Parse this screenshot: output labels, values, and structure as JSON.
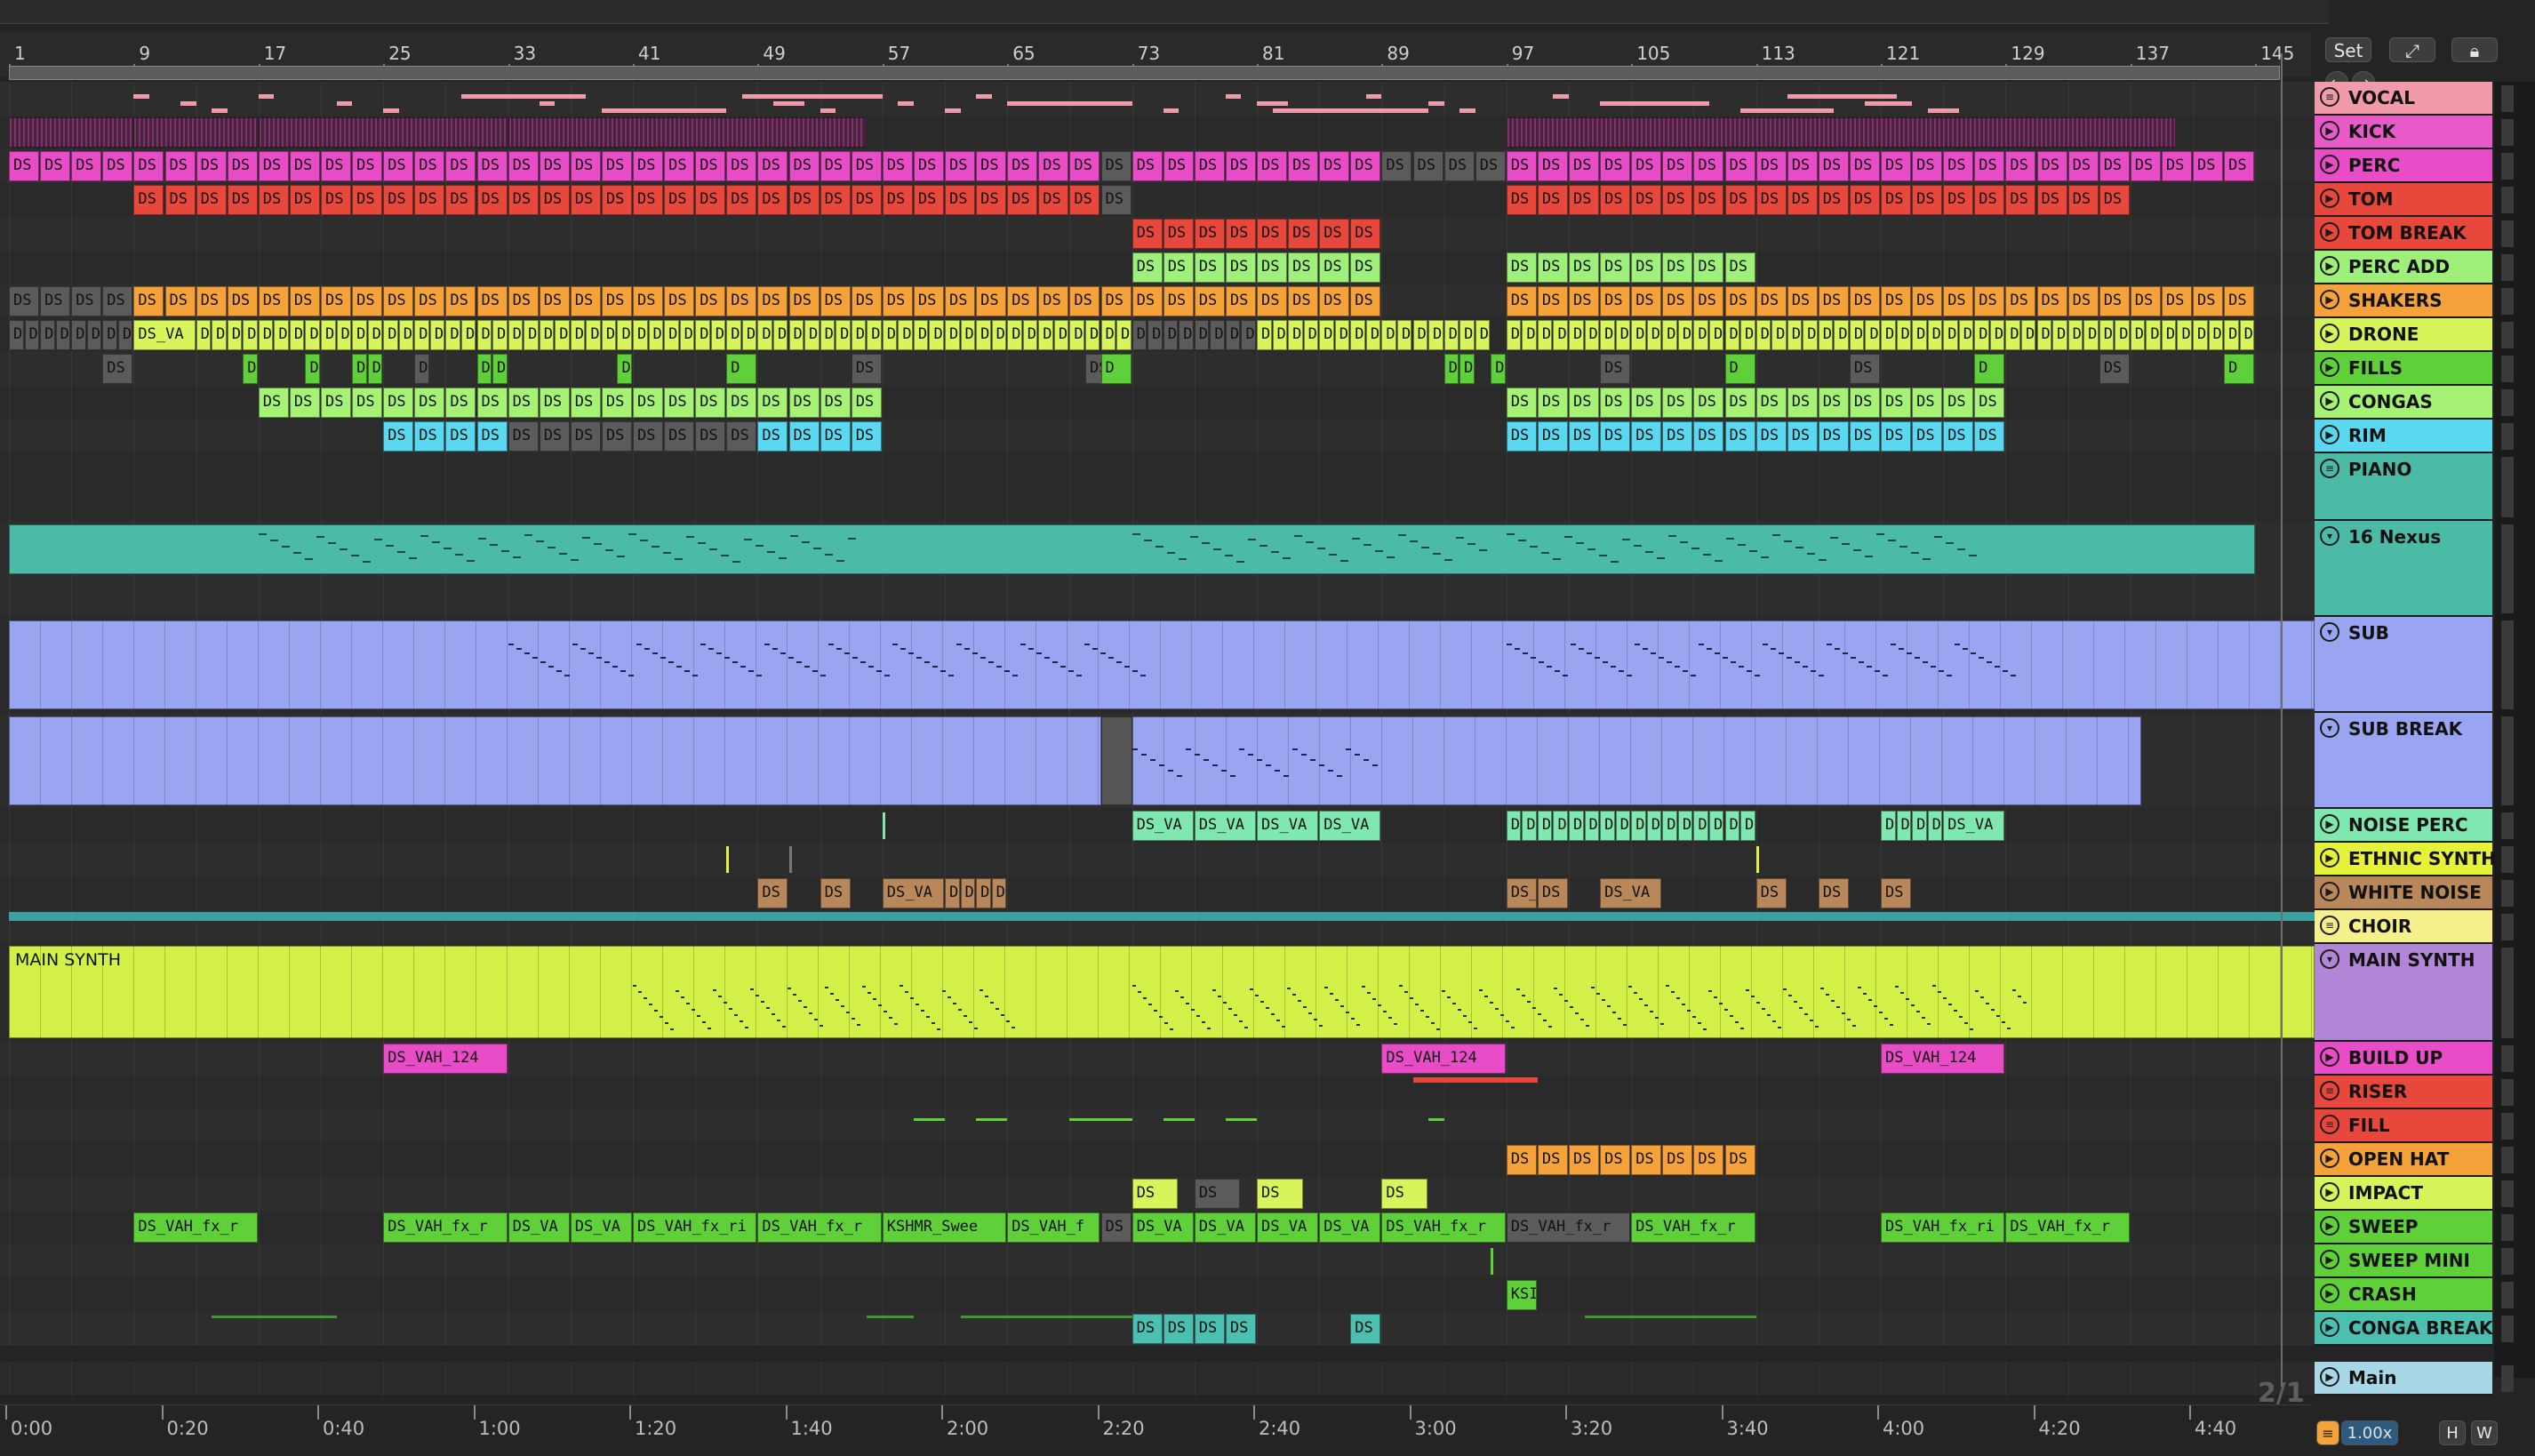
{
  "session": {
    "set_button": "Set",
    "time_signature": "2/1",
    "zoom": "1.00x",
    "h_button": "H",
    "w_button": "W"
  },
  "ruler": {
    "bars": [
      "1",
      "9",
      "17",
      "25",
      "33",
      "41",
      "49",
      "57",
      "65",
      "73",
      "81",
      "89",
      "97",
      "105",
      "113",
      "121",
      "129",
      "137",
      "145"
    ]
  },
  "time_ruler": {
    "times": [
      "0:00",
      "0:20",
      "0:40",
      "1:00",
      "1:20",
      "1:40",
      "2:00",
      "2:20",
      "2:40",
      "3:00",
      "3:20",
      "3:40",
      "4:00",
      "4:20",
      "4:40"
    ]
  },
  "colors": {
    "vocal": "#f09aaa",
    "kick": "#e85ac8",
    "perc": "#e84cc6",
    "tom": "#e8473c",
    "tom_break": "#e8473c",
    "perc_add": "#9ef07a",
    "shakers": "#f5a23a",
    "drone": "#d7f55a",
    "fills": "#5fd03a",
    "congas": "#a6f275",
    "rim": "#5ad8f0",
    "piano": "#4bbba8",
    "nexus": "#4bbba8",
    "sub": "#99a5f0",
    "sub_break": "#99a5f0",
    "noise_perc": "#7ee8b0",
    "ethnic_synth": "#e6f23a",
    "white_noise": "#b9885a",
    "choir": "#f5f08c",
    "main_synth": "#d2f048",
    "main_synth_head": "#b286d6",
    "build_up": "#e84cc6",
    "riser": "#e8473c",
    "fill": "#e8473c",
    "open_hat": "#f5a23a",
    "impact": "#d7f55a",
    "sweep": "#5fd03a",
    "sweep_mini": "#5fd03a",
    "crash": "#5fd03a",
    "conga_break": "#4bc0b0",
    "main": "#a8d8e8"
  },
  "tracks": [
    {
      "name": "VOCAL",
      "icon": "menu-icon"
    },
    {
      "name": "KICK",
      "icon": "play-icon"
    },
    {
      "name": "PERC",
      "icon": "play-icon"
    },
    {
      "name": "TOM",
      "icon": "play-icon"
    },
    {
      "name": "TOM BREAK",
      "icon": "play-icon"
    },
    {
      "name": "PERC ADD",
      "icon": "play-icon"
    },
    {
      "name": "SHAKERS",
      "icon": "play-icon"
    },
    {
      "name": "DRONE",
      "icon": "play-icon"
    },
    {
      "name": "FILLS",
      "icon": "play-icon"
    },
    {
      "name": "CONGAS",
      "icon": "play-icon"
    },
    {
      "name": "RIM",
      "icon": "play-icon"
    },
    {
      "name": "PIANO",
      "icon": "menu-icon"
    },
    {
      "name": "16 Nexus",
      "icon": "chevron-down-icon"
    },
    {
      "name": "SUB",
      "icon": "chevron-down-icon"
    },
    {
      "name": "SUB BREAK",
      "icon": "chevron-down-icon"
    },
    {
      "name": "NOISE PERC",
      "icon": "play-icon"
    },
    {
      "name": "ETHNIC SYNTH",
      "icon": "play-icon"
    },
    {
      "name": "WHITE NOISE",
      "icon": "play-icon"
    },
    {
      "name": "CHOIR",
      "icon": "menu-icon"
    },
    {
      "name": "MAIN SYNTH",
      "icon": "chevron-down-icon"
    },
    {
      "name": "BUILD UP",
      "icon": "play-icon"
    },
    {
      "name": "RISER",
      "icon": "menu-icon"
    },
    {
      "name": "FILL",
      "icon": "menu-icon"
    },
    {
      "name": "OPEN HAT",
      "icon": "play-icon"
    },
    {
      "name": "IMPACT",
      "icon": "play-icon"
    },
    {
      "name": "SWEEP",
      "icon": "play-icon"
    },
    {
      "name": "SWEEP MINI",
      "icon": "play-icon"
    },
    {
      "name": "CRASH",
      "icon": "play-icon"
    },
    {
      "name": "CONGA BREAK",
      "icon": "play-icon"
    },
    {
      "name": "Main",
      "icon": "play-icon"
    }
  ],
  "clip_labels": {
    "ds": "DS",
    "d": "D",
    "ds_va": "DS_VA",
    "ds_vah_124": "DS_VAH_124",
    "ds_vah_fx": "DS_VAH_fx_r",
    "ds_vah_fx2": "DS_VAH_fx_ri",
    "ds_vah_f": "DS_VAH_f",
    "kshmr": "KSHMR_Swee",
    "ksi": "KSI",
    "ds_va_drone": "DS_VA",
    "main_synth_clip": "MAIN SYNTH"
  }
}
